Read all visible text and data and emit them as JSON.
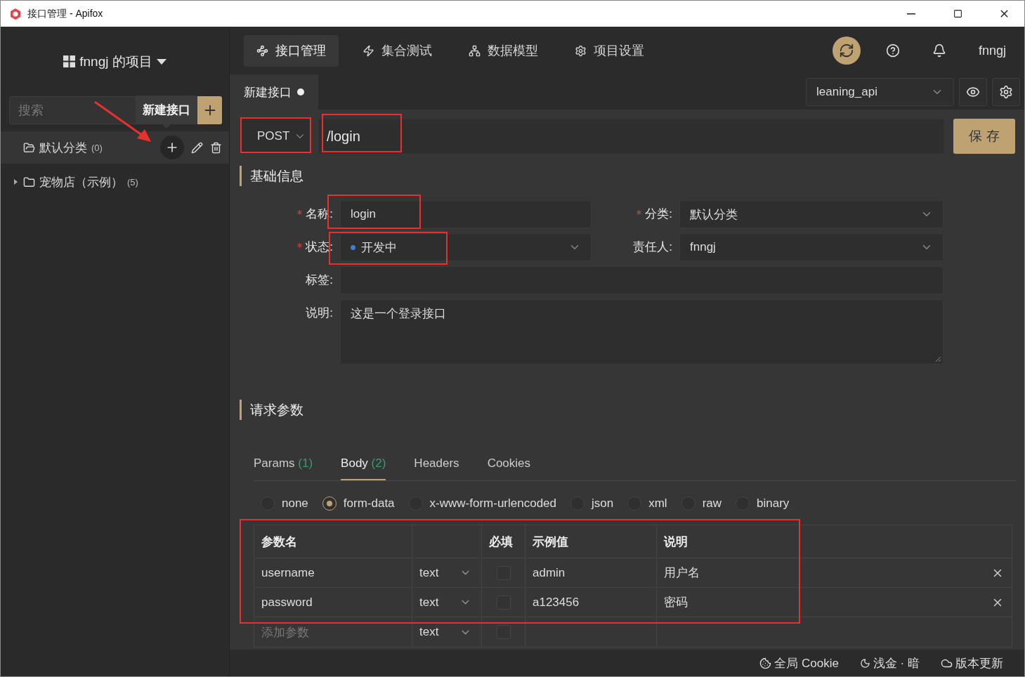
{
  "window": {
    "title": "接口管理 - Apifox"
  },
  "sidebar": {
    "project": "fnngj 的项目",
    "search": {
      "placeholder": "搜索"
    },
    "tooltip": "新建接口",
    "tree": [
      {
        "label": "默认分类",
        "count": "(0)",
        "selected": true,
        "expanded": true
      },
      {
        "label": "宠物店（示例）",
        "count": "(5)",
        "selected": false,
        "expanded": false
      }
    ]
  },
  "nav": {
    "tabs": [
      {
        "kind": "api",
        "label": "接口管理",
        "selected": true
      },
      {
        "kind": "test",
        "label": "集合测试",
        "selected": false
      },
      {
        "kind": "model",
        "label": "数据模型",
        "selected": false
      },
      {
        "kind": "settings",
        "label": "项目设置",
        "selected": false
      }
    ],
    "user": "fnngj"
  },
  "doc_tabs": [
    {
      "label": "新建接口",
      "modified": true
    }
  ],
  "environment": "leaning_api",
  "request": {
    "method": "POST",
    "path": "/login",
    "save": "保 存"
  },
  "basic": {
    "title": "基础信息",
    "rows": [
      [
        {
          "label": "名称:",
          "required": true,
          "kind": "input",
          "value": "login"
        },
        {
          "label": "分类:",
          "required": true,
          "kind": "select",
          "value": "默认分类"
        }
      ],
      [
        {
          "label": "状态:",
          "required": true,
          "kind": "status",
          "value": "开发中",
          "color": "#3b7fe0"
        },
        {
          "label": "责任人:",
          "required": false,
          "kind": "select",
          "value": "fnngj"
        }
      ],
      [
        {
          "label": "标签:",
          "required": false,
          "kind": "input"
        }
      ],
      [
        {
          "label": "说明:",
          "required": false,
          "kind": "textarea",
          "value": "这是一个登录接口"
        }
      ]
    ]
  },
  "params": {
    "title": "请求参数",
    "tabs": [
      {
        "label": "Params",
        "count": "(1)",
        "selected": false
      },
      {
        "label": "Body",
        "count": "(2)",
        "selected": true
      },
      {
        "label": "Headers",
        "selected": false
      },
      {
        "label": "Cookies",
        "selected": false
      }
    ],
    "body_types": [
      {
        "label": "none",
        "selected": false
      },
      {
        "label": "form-data",
        "selected": true
      },
      {
        "label": "x-www-form-urlencoded",
        "selected": false
      },
      {
        "label": "json",
        "selected": false
      },
      {
        "label": "xml",
        "selected": false
      },
      {
        "label": "raw",
        "selected": false
      },
      {
        "label": "binary",
        "selected": false
      }
    ],
    "table": {
      "columns": {
        "name": "参数名",
        "required": "必填",
        "example": "示例值",
        "description": "说明"
      },
      "rows": [
        {
          "name": "username",
          "type": "text",
          "required": false,
          "example": "admin",
          "description": "用户名"
        },
        {
          "name": "password",
          "type": "text",
          "required": false,
          "example": "a123456",
          "description": "密码"
        }
      ],
      "add_row": {
        "placeholder": "添加参数",
        "type": "text",
        "required": false
      }
    }
  },
  "status_bar": [
    {
      "kind": "cookie",
      "label": "全局 Cookie"
    },
    {
      "kind": "theme",
      "label": "浅金 · 暗"
    },
    {
      "kind": "update",
      "label": "版本更新"
    }
  ]
}
